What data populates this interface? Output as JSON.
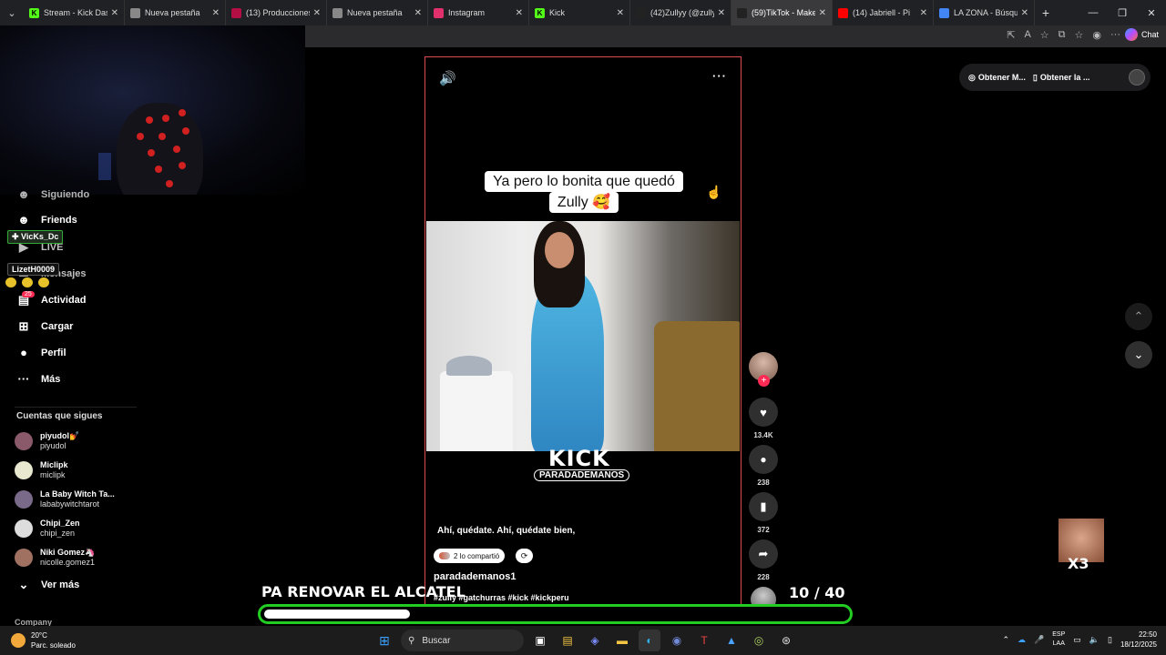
{
  "browser": {
    "tabs": [
      {
        "label": "Stream - Kick Dashb",
        "favicon_color": "#53fc18",
        "favicon_char": "K",
        "active": false
      },
      {
        "label": "Nueva pestaña",
        "favicon_color": "#888888",
        "favicon_char": "",
        "active": false
      },
      {
        "label": "(13) Producciones le",
        "favicon_color": "#b30f45",
        "favicon_char": "",
        "active": false
      },
      {
        "label": "Nueva pestaña",
        "favicon_color": "#888888",
        "favicon_char": "",
        "active": false
      },
      {
        "label": "Instagram",
        "favicon_color": "#e1306c",
        "favicon_char": "",
        "active": false
      },
      {
        "label": "Kick",
        "favicon_color": "#53fc18",
        "favicon_char": "K",
        "active": false
      },
      {
        "label": "(42)Zullyy (@zullyy_",
        "favicon_color": "#222222",
        "favicon_char": "",
        "active": false
      },
      {
        "label": "(59)TikTok - Make Yo",
        "favicon_color": "#222222",
        "favicon_char": "",
        "active": true
      },
      {
        "label": "(14) Jabriell - Pi",
        "favicon_color": "#ff0000",
        "favicon_char": "",
        "active": false
      },
      {
        "label": "LA ZONA - Búsqueda",
        "favicon_color": "#4285f4",
        "favicon_char": "",
        "active": false
      }
    ],
    "new_tab": "+",
    "chat_label": "Chat"
  },
  "sidebar": {
    "nav": [
      {
        "label": "Siguiendo",
        "icon": "following-icon",
        "glyph": "☻"
      },
      {
        "label": "Friends",
        "icon": "friends-icon",
        "glyph": "👥"
      },
      {
        "label": "LIVE",
        "icon": "live-icon",
        "glyph": "▶"
      },
      {
        "label": "Mensajes",
        "icon": "messages-icon",
        "glyph": "✉"
      },
      {
        "label": "Actividad",
        "icon": "activity-icon",
        "glyph": "💬"
      },
      {
        "label": "Cargar",
        "icon": "upload-icon",
        "glyph": "⊞"
      },
      {
        "label": "Perfil",
        "icon": "profile-icon",
        "glyph": "●"
      },
      {
        "label": "Más",
        "icon": "more-icon",
        "glyph": "···"
      }
    ],
    "activity_badge": "25",
    "following_title": "Cuentas que sigues",
    "following": [
      {
        "name": "piyudol💅",
        "user": "piyudol",
        "color": "#8b5a6a"
      },
      {
        "name": "Miclipk",
        "user": "miclipk",
        "color": "#e8e8d0"
      },
      {
        "name": "La Baby Witch Ta...",
        "user": "lababywitchtarot",
        "color": "#7a6a8a"
      },
      {
        "name": "Chipi_Zen",
        "user": "chipi_zen",
        "color": "#dddddd"
      },
      {
        "name": "Niki Gomez🦄",
        "user": "nicolle.gomez1",
        "color": "#a07060"
      }
    ],
    "see_more": "Ver más",
    "company": "Company"
  },
  "chat_overlay": {
    "user1": "VicKs_Dc",
    "user2": "LizetH0009"
  },
  "video": {
    "caption_line1": "Ya pero lo bonita que quedó",
    "caption_line2": "Zully 🥰",
    "watermark": "KICK",
    "watermark_sub": "PARADADEMANOS",
    "subtitle": "Ahí, quédate. Ahí, quédate bien,",
    "shared_label": "2 lo compartió",
    "author": "paradademanos1",
    "hashtags": "#zully #gatchurras #kick #kickperu"
  },
  "actions": {
    "likes": "13.4K",
    "comments": "238",
    "saves": "372",
    "shares": "228"
  },
  "top_right": {
    "item1": "Obtener M...",
    "item2": "Obtener la ..."
  },
  "stream_overlay": {
    "goal_title": "PA RENOVAR EL ALCATEL",
    "goal_current": "10",
    "goal_total": "/ 40",
    "goal_progress": 0.25,
    "multiplier": "X3",
    "accent_color": "#22cc22"
  },
  "taskbar": {
    "temperature": "20°C",
    "weather": "Parc. soleado",
    "search_placeholder": "Buscar",
    "lang_line1": "ESP",
    "lang_line2": "LAA",
    "time": "22:50",
    "date": "18/12/2025"
  }
}
